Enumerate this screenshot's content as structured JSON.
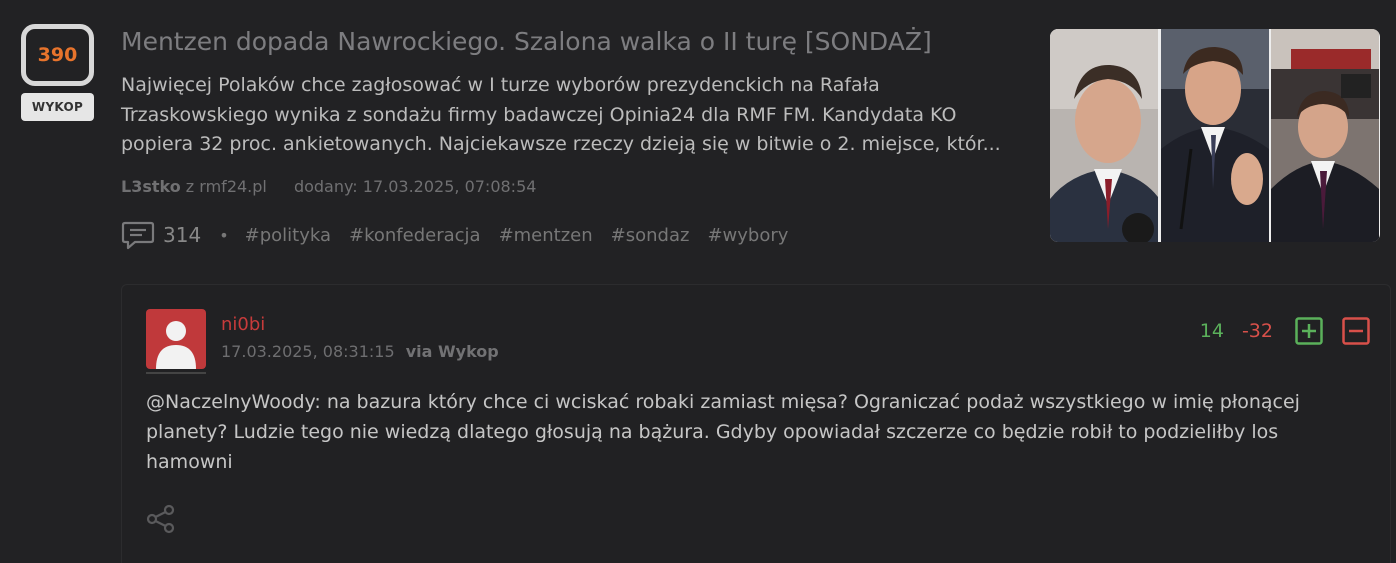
{
  "article": {
    "score": "390",
    "vote_button": "WYKOP",
    "title": "Mentzen dopada Nawrockiego. Szalona walka o II turę [SONDAŻ]",
    "description": "Najwięcej Polaków chce zagłosować w I turze wyborów prezydenckich na Rafała Trzaskowskiego wynika z sondażu firmy badawczej Opinia24 dla RMF FM. Kandydata KO popiera 32 proc. ankietowanych. Najciekawsze rzeczy dzieją się w bitwie o 2. miejsce, któr...",
    "author": "L3stko",
    "source_prefix": "z",
    "source": "rmf24.pl",
    "added": "dodany: 17.03.2025, 07:08:54",
    "comment_count": "314",
    "separator": "•",
    "tags": [
      "#polityka",
      "#konfederacja",
      "#mentzen",
      "#sondaz",
      "#wybory"
    ]
  },
  "comment": {
    "username": "ni0bi",
    "timestamp": "17.03.2025, 08:31:15",
    "via": "via Wykop",
    "plus": "14",
    "minus": "-32",
    "mention": "@NaczelnyWoody:",
    "text": " na bazura który chce ci wciskać robaki zamiast mięsa? Ograniczać podaż wszystkiego w imię płonącej planety? Ludzie tego nie wiedzą dlatego głosują na bążura. Gdyby opowiadał szczerze co będzie robił to podzieliłby los hamowni"
  },
  "colors": {
    "background": "#222224",
    "score": "#e8742c",
    "username": "#c73b3b",
    "plus": "#5bb15b",
    "minus": "#d8504a"
  },
  "icons": {
    "comments": "comments-icon",
    "plus": "plus-square-icon",
    "minus": "minus-square-icon",
    "share": "share-icon",
    "avatar": "default-user-avatar"
  }
}
